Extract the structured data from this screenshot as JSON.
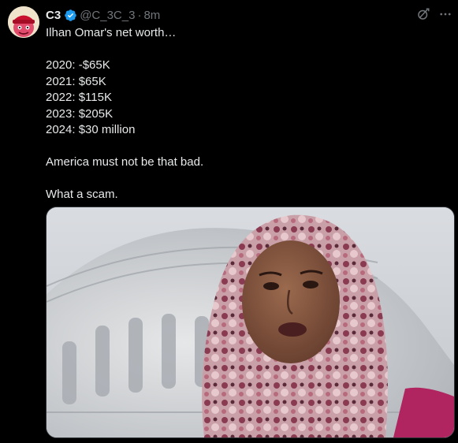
{
  "post": {
    "author": {
      "display_name": "C3",
      "handle": "@C_3C_3",
      "verified": true,
      "avatar_icon": "avatar-red-cap-icon"
    },
    "time": "8m",
    "separator": "·",
    "text_lines": [
      "Ilhan Omar's net worth…",
      "",
      "2020: -$65K",
      "2021: $65K",
      "2022: $115K",
      "2023: $205K",
      "2024: $30 million",
      "",
      "America must not be that bad.",
      "",
      "What a scam."
    ],
    "media": {
      "type": "photo",
      "icon": "photo-woman-headscarf-capitol-dome"
    }
  },
  "colors": {
    "background": "#000000",
    "text": "#e7e9ea",
    "secondary": "#71767b",
    "verified_badge": "#1d9bf0"
  }
}
